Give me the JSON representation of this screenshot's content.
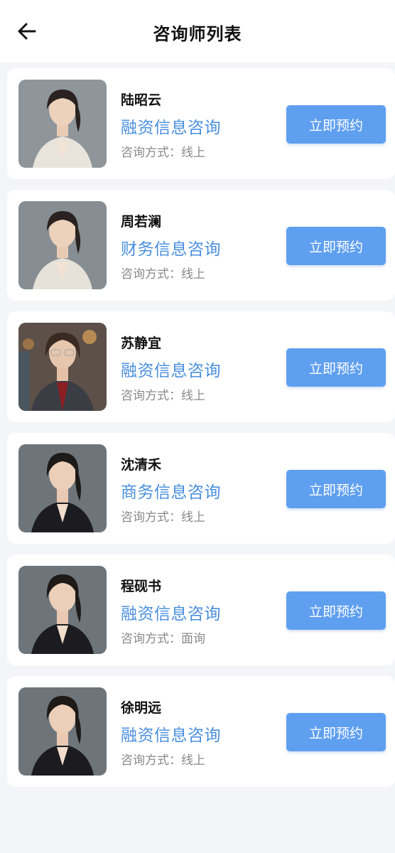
{
  "header": {
    "title": "咨询师列表",
    "back_icon": "arrow-left-icon"
  },
  "consultants": [
    {
      "name": "陆昭云",
      "type": "融资信息咨询",
      "method_label": "咨询方式：线上",
      "button": "立即预约",
      "photo_bg": "#9aa0a6"
    },
    {
      "name": "周若澜",
      "type": "财务信息咨询",
      "method_label": "咨询方式：线上",
      "button": "立即预约",
      "photo_bg": "#8f979c"
    },
    {
      "name": "苏静宜",
      "type": "融资信息咨询",
      "method_label": "咨询方式：线上",
      "button": "立即预约",
      "photo_bg": "#7a6a5c"
    },
    {
      "name": "沈清禾",
      "type": "商务信息咨询",
      "method_label": "咨询方式：线上",
      "button": "立即预约",
      "photo_bg": "#6f767c"
    },
    {
      "name": "程砚书",
      "type": "融资信息咨询",
      "method_label": "咨询方式：面询",
      "button": "立即预约",
      "photo_bg": "#6f767c"
    },
    {
      "name": "徐明远",
      "type": "融资信息咨询",
      "method_label": "咨询方式：线上",
      "button": "立即预约",
      "photo_bg": "#6f767c"
    }
  ],
  "colors": {
    "accent": "#5f9ff0",
    "type_text": "#4a8fdd",
    "background": "#f4f5f9"
  }
}
